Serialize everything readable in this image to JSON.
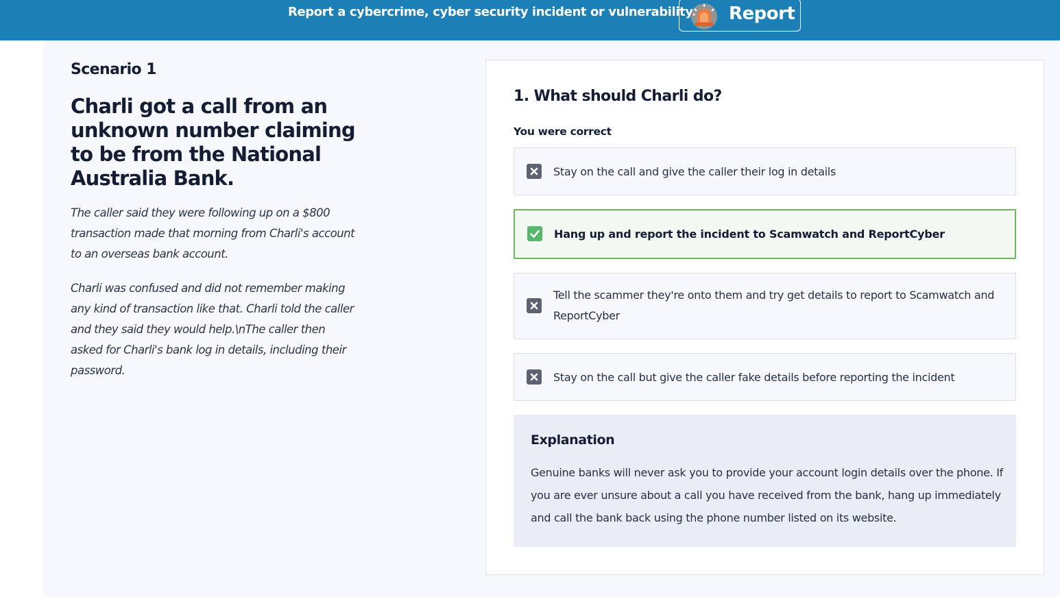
{
  "banner": {
    "text": "Report a cybercrime, cyber security incident or vulnerability.",
    "button_label": "Report",
    "button_icon": "siren-icon"
  },
  "scenario": {
    "label": "Scenario 1",
    "title": "Charli got a call from an unknown number claiming to be from the National Australia Bank.",
    "paragraphs": [
      "The caller said they were following up on a $800 transaction made that morning from Charli's account to an overseas bank account.",
      "Charli was confused and did not remember making any kind of transaction like that. Charli told the caller and they said they would help.\\nThe caller then asked for Charli's bank log in details, including their password."
    ]
  },
  "quiz": {
    "question": "1. What should Charli do?",
    "result": "You were correct",
    "options": [
      {
        "text": "Stay on the call and give the caller their log in details",
        "status": "incorrect",
        "icon": "x-icon"
      },
      {
        "text": "Hang up and report the incident to Scamwatch and ReportCyber",
        "status": "correct",
        "icon": "check-icon"
      },
      {
        "text": "Tell the scammer they're onto them and try get details to report to Scamwatch and ReportCyber",
        "status": "incorrect",
        "icon": "x-icon"
      },
      {
        "text": "Stay on the call but give the caller fake details before reporting the incident",
        "status": "incorrect",
        "icon": "x-icon"
      }
    ],
    "explanation": {
      "title": "Explanation",
      "body": "Genuine banks will never ask you to provide your account login details over the phone. If you are ever unsure about a call you have received from the bank, hang up immediately and call the bank back using the phone number listed on its website."
    }
  },
  "colors": {
    "banner": "#1c7fb6",
    "correct": "#56b86a",
    "incorrect": "#5c6270",
    "siren": "#f07a3a"
  }
}
